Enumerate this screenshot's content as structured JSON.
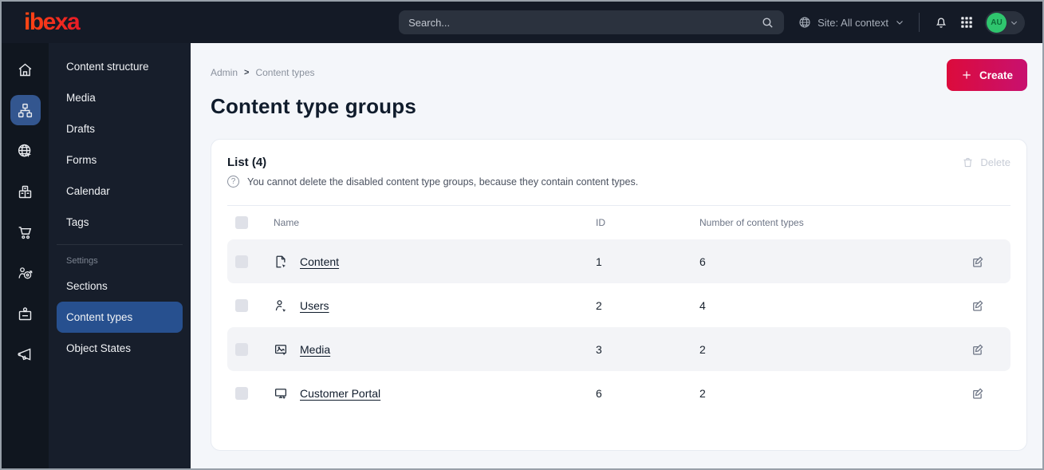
{
  "topbar": {
    "logo_text": "ibexa",
    "search_placeholder": "Search...",
    "site_context_label": "Site: All context",
    "avatar_initials": "AU"
  },
  "sidebar": {
    "rail_icons": [
      "home-icon",
      "content-tree-icon",
      "site-globe-icon",
      "products-icon",
      "cart-icon",
      "personalization-icon",
      "corporate-badge-icon",
      "campaign-megaphone-icon"
    ],
    "menu_items": [
      {
        "label": "Content structure"
      },
      {
        "label": "Media"
      },
      {
        "label": "Drafts"
      },
      {
        "label": "Forms"
      },
      {
        "label": "Calendar"
      },
      {
        "label": "Tags"
      },
      {
        "label": "Sections"
      },
      {
        "label": "Content types",
        "active": true
      },
      {
        "label": "Object States"
      }
    ],
    "settings_header": "Settings"
  },
  "breadcrumb": {
    "items": [
      "Admin",
      "Content types"
    ],
    "separator": ">"
  },
  "page": {
    "title": "Content type groups",
    "create_label": "Create"
  },
  "list": {
    "title": "List (4)",
    "info_text": "You cannot delete the disabled content type groups, because they contain content types.",
    "delete_label": "Delete",
    "table": {
      "columns": [
        "Name",
        "ID",
        "Number of content types"
      ],
      "rows": [
        {
          "icon": "content-file-icon",
          "name": "Content",
          "id": "1",
          "count": "6"
        },
        {
          "icon": "users-person-icon",
          "name": "Users",
          "id": "2",
          "count": "4"
        },
        {
          "icon": "media-image-icon",
          "name": "Media",
          "id": "3",
          "count": "2"
        },
        {
          "icon": "portal-monitor-icon",
          "name": "Customer Portal",
          "id": "6",
          "count": "2"
        }
      ]
    }
  },
  "colors": {
    "topbar_bg": "#141a26",
    "active_blue": "#27508f",
    "accent_gradient_start": "#dc0b3c",
    "accent_gradient_end": "#c8116f",
    "avatar_green": "#2fc56e",
    "stripe_bg": "#f3f4f7"
  }
}
